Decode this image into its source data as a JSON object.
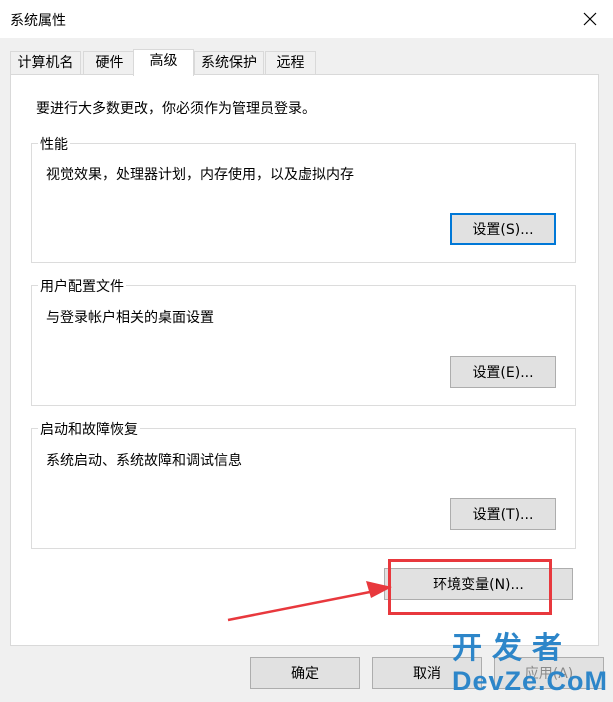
{
  "window": {
    "title": "系统属性"
  },
  "tabs": [
    {
      "label": "计算机名"
    },
    {
      "label": "硬件"
    },
    {
      "label": "高级"
    },
    {
      "label": "系统保护"
    },
    {
      "label": "远程"
    }
  ],
  "active_tab": "高级",
  "admin_note": "要进行大多数更改，你必须作为管理员登录。",
  "groups": {
    "performance": {
      "title": "性能",
      "description": "视觉效果，处理器计划，内存使用，以及虚拟内存",
      "button": "设置(S)..."
    },
    "user_profiles": {
      "title": "用户配置文件",
      "description": "与登录帐户相关的桌面设置",
      "button": "设置(E)..."
    },
    "startup_recovery": {
      "title": "启动和故障恢复",
      "description": "系统启动、系统故障和调试信息",
      "button": "设置(T)..."
    }
  },
  "env_button": "环境变量(N)...",
  "footer": {
    "ok": "确定",
    "cancel": "取消",
    "apply": "应用(A)"
  },
  "watermark": {
    "line1": "开发者",
    "line2": "DevZe.CoM"
  },
  "colors": {
    "highlight": "#e8383d",
    "watermark": "#2d86c9",
    "focus": "#0078d7"
  }
}
